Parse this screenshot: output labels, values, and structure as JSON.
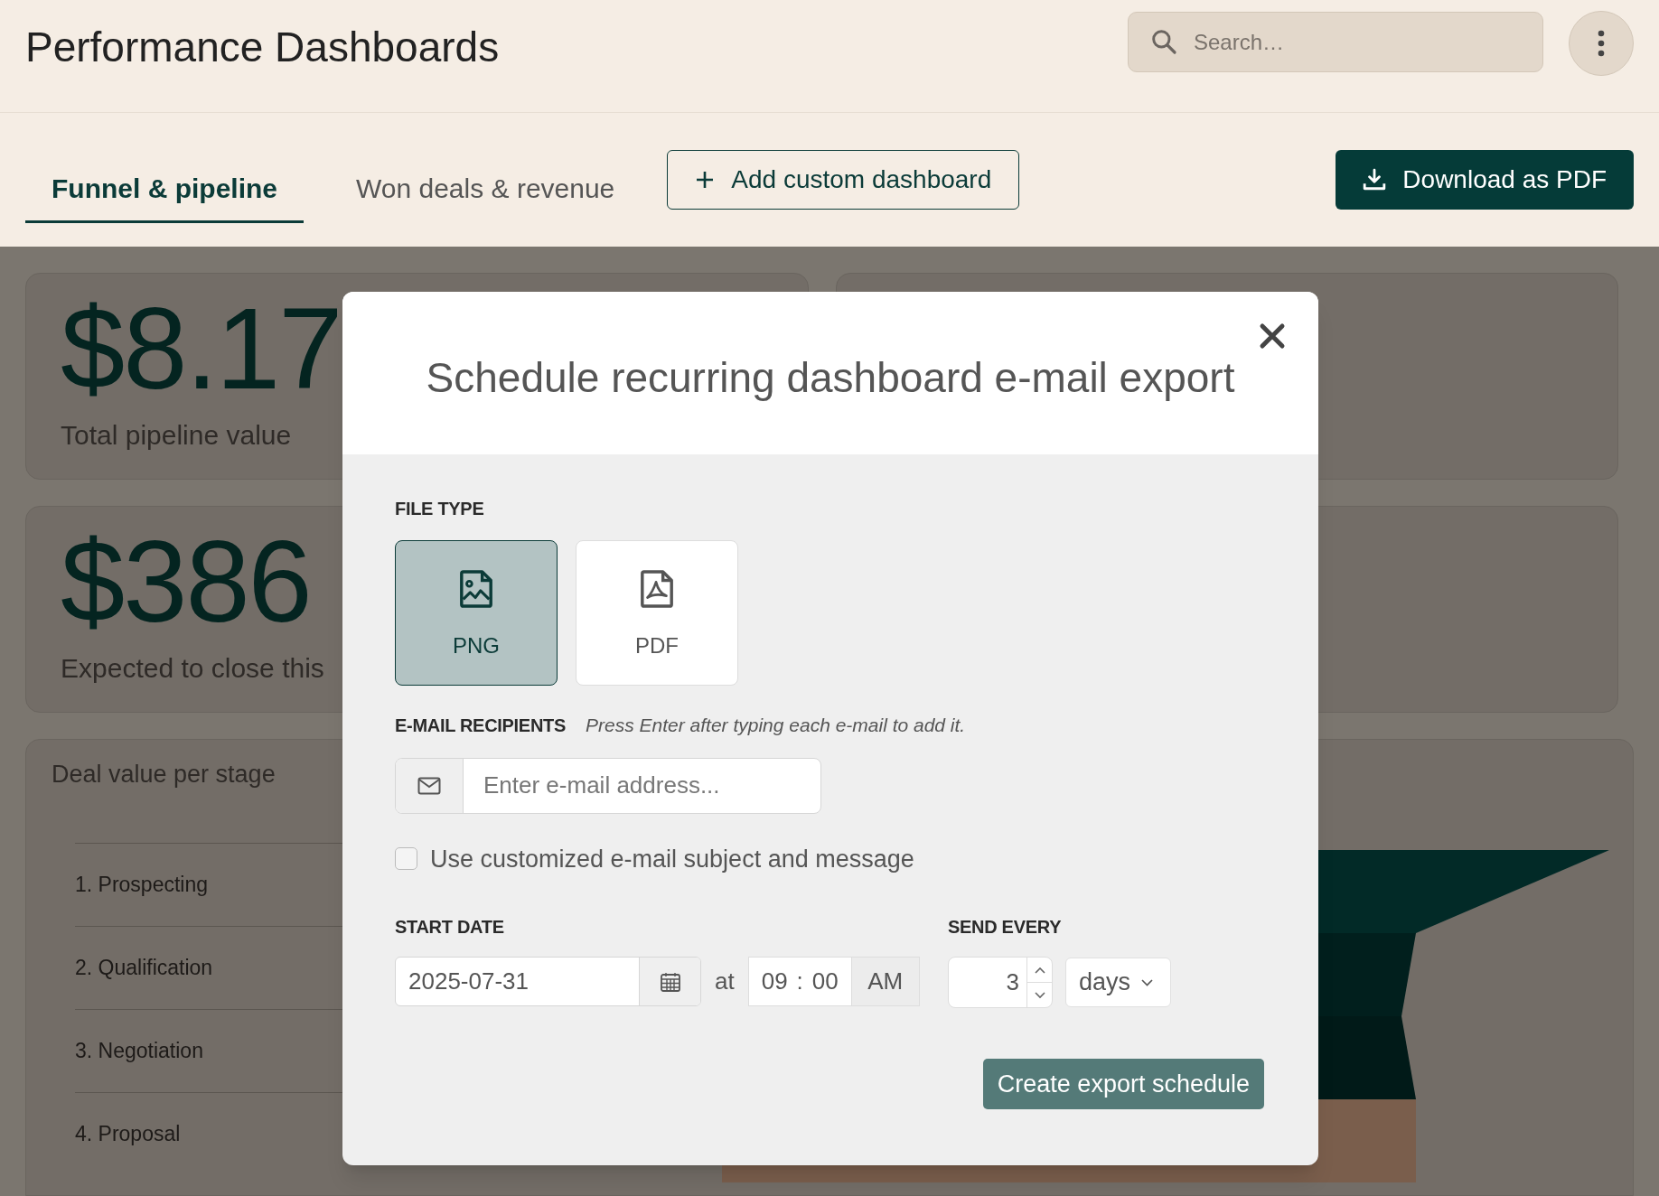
{
  "header": {
    "title": "Performance Dashboards",
    "search": {
      "placeholder": "Search…"
    }
  },
  "tabs": [
    {
      "label": "Funnel & pipeline",
      "selected": true
    },
    {
      "label": "Won deals & revenue",
      "selected": false
    }
  ],
  "add_button": "Add custom dashboard",
  "download_button": "Download as PDF",
  "cards": [
    {
      "value": "$8.17",
      "label": "Total pipeline value"
    },
    {
      "value": "$386",
      "label": "Expected to close this"
    }
  ],
  "chart_card": {
    "title": "Deal value per stage",
    "stages": [
      "1. Prospecting",
      "2. Qualification",
      "3. Negotiation",
      "4. Proposal"
    ]
  },
  "modal": {
    "title": "Schedule recurring dashboard e-mail export",
    "file_type": {
      "label": "FILE TYPE",
      "options": [
        {
          "label": "PNG",
          "kind": "image",
          "selected": true
        },
        {
          "label": "PDF",
          "kind": "pdf",
          "selected": false
        }
      ]
    },
    "recipients": {
      "label": "E-MAIL RECIPIENTS",
      "hint": "Press Enter after typing each e-mail to add it.",
      "placeholder": "Enter e-mail address..."
    },
    "custom_message": {
      "label": "Use customized e-mail subject and message",
      "checked": false
    },
    "start_date": {
      "label": "START DATE",
      "date": "2025-07-31",
      "at": "at",
      "hour": "09",
      "separator": ":",
      "minute": "00",
      "period": "AM"
    },
    "send_every": {
      "label": "SEND EVERY",
      "count": "3",
      "unit": "days"
    },
    "submit": "Create export schedule"
  }
}
